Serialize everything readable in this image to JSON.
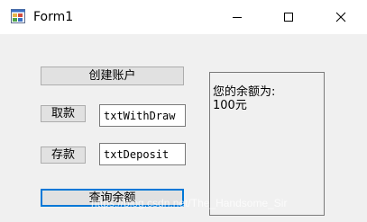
{
  "window": {
    "title": "Form1"
  },
  "buttons": {
    "create_account": "创建账户",
    "withdraw": "取款",
    "deposit": "存款",
    "query_balance": "查询余额"
  },
  "inputs": {
    "withdraw_value": "txtWithDraw",
    "deposit_value": "txtDeposit"
  },
  "balance": {
    "label": "您的余额为:",
    "amount": "100元"
  },
  "watermark": "https://blog.csdn.net/The_Handsome_Sir",
  "colors": {
    "focus_border": "#0078d7",
    "button_face": "#e1e1e1",
    "window_bg": "#f0f0f0"
  }
}
